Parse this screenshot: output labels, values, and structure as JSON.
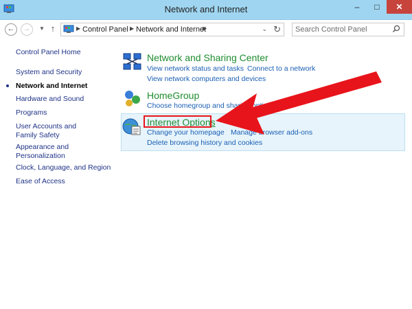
{
  "window": {
    "title": "Network and Internet",
    "controls": {
      "minimize": "–",
      "maximize": "□",
      "close": "✕"
    }
  },
  "address_bar": {
    "crumbs": [
      "Control Panel",
      "Network and Internet"
    ],
    "search_placeholder": "Search Control Panel"
  },
  "left_nav": {
    "items": [
      {
        "label": "Control Panel Home",
        "current": false
      },
      {
        "label": "System and Security",
        "current": false
      },
      {
        "label": "Network and Internet",
        "current": true
      },
      {
        "label": "Hardware and Sound",
        "current": false
      },
      {
        "label": "Programs",
        "current": false
      },
      {
        "label": "User Accounts and Family Safety",
        "current": false
      },
      {
        "label": "Appearance and Personalization",
        "current": false
      },
      {
        "label": "Clock, Language, and Region",
        "current": false
      },
      {
        "label": "Ease of Access",
        "current": false
      }
    ]
  },
  "categories": [
    {
      "title": "Network and Sharing Center",
      "icon": "network-icon",
      "links": [
        "View network status and tasks",
        "Connect to a network",
        "View network computers and devices"
      ]
    },
    {
      "title": "HomeGroup",
      "icon": "homegroup-icon",
      "links": [
        "Choose homegroup and sharing options"
      ]
    },
    {
      "title": "Internet Options",
      "icon": "internet-options-icon",
      "links": [
        "Change your homepage",
        "Manage browser add-ons",
        "Delete browsing history and cookies"
      ]
    }
  ],
  "annotation": {
    "color": "#e8141b",
    "target": "Internet Options"
  },
  "colors": {
    "title_bar": "#9fd5f0",
    "category_title": "#1e8c2f",
    "link": "#1a5fb4",
    "highlight": "#e7f4fb"
  }
}
